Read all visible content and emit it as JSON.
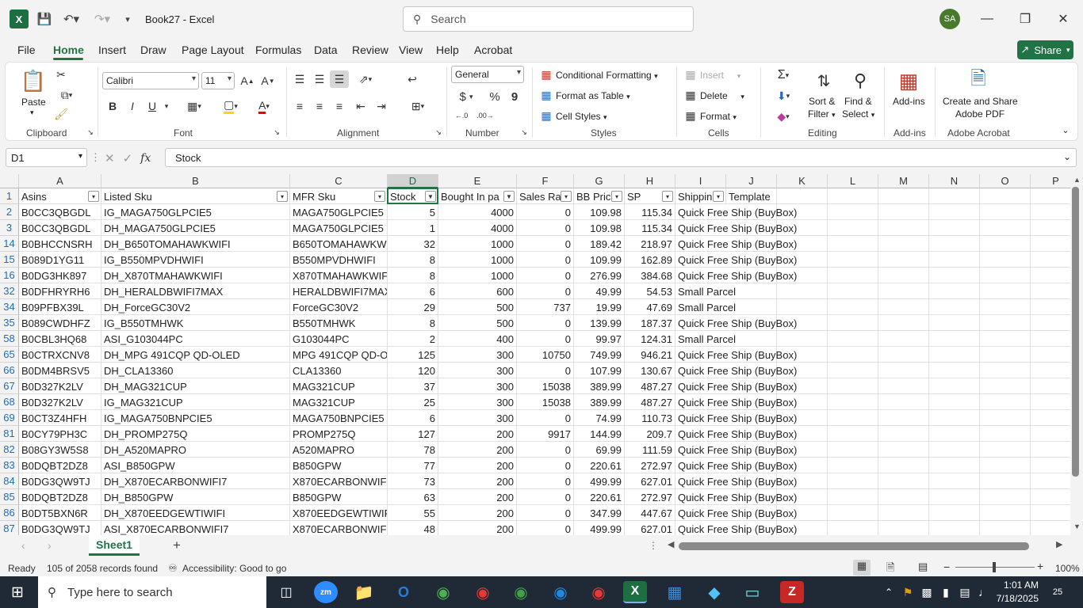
{
  "titlebar": {
    "doc_title": "Book27 - Excel",
    "search_placeholder": "Search",
    "user_initials": "SA"
  },
  "menu": {
    "tabs": [
      "File",
      "Home",
      "Insert",
      "Draw",
      "Page Layout",
      "Formulas",
      "Data",
      "Review",
      "View",
      "Help",
      "Acrobat"
    ],
    "active_tab": "Home",
    "share_label": "Share"
  },
  "ribbon": {
    "clipboard": {
      "paste": "Paste",
      "label": "Clipboard"
    },
    "font": {
      "name": "Calibri",
      "size": "11",
      "bold": "B",
      "italic": "I",
      "underline": "U",
      "label": "Font"
    },
    "alignment": {
      "label": "Alignment"
    },
    "number": {
      "format": "General",
      "currency": "$",
      "percent": "%",
      "comma": "9",
      "label": "Number"
    },
    "styles": {
      "conditional": "Conditional Formatting",
      "format_table": "Format as Table",
      "cell_styles": "Cell Styles",
      "label": "Styles"
    },
    "cells": {
      "insert": "Insert",
      "delete": "Delete",
      "format": "Format",
      "label": "Cells"
    },
    "editing": {
      "sort": "Sort &",
      "filter": "Filter",
      "find": "Find &",
      "select": "Select",
      "label": "Editing"
    },
    "addins": {
      "button": "Add-ins",
      "label": "Add-ins"
    },
    "acrobat": {
      "line1": "Create and Share",
      "line2": "Adobe PDF",
      "label": "Adobe Acrobat"
    }
  },
  "formula_bar": {
    "name_box": "D1",
    "fx": "fx",
    "content": "Stock"
  },
  "columns": [
    "A",
    "B",
    "C",
    "D",
    "E",
    "F",
    "G",
    "H",
    "I",
    "J",
    "K",
    "L",
    "M",
    "N",
    "O",
    "P"
  ],
  "header_row": {
    "row_num": "1",
    "cells": [
      "Asins",
      "Listed Sku",
      "MFR Sku",
      "Stock",
      "Bought In pa",
      "Sales Ra",
      "BB Pric",
      "SP",
      "Shippin",
      "Template"
    ]
  },
  "rows": [
    {
      "n": "2",
      "a": "B0CC3QBGDL",
      "b": "IG_MAGA750GLPCIE5",
      "c": "MAGA750GLPCIE5",
      "d": "5",
      "e": "4000",
      "f": "0",
      "g": "109.98",
      "h": "115.34",
      "i": "Quick Free Ship (BuyBox)"
    },
    {
      "n": "3",
      "a": "B0CC3QBGDL",
      "b": "DH_MAGA750GLPCIE5",
      "c": "MAGA750GLPCIE5",
      "d": "1",
      "e": "4000",
      "f": "0",
      "g": "109.98",
      "h": "115.34",
      "i": "Quick Free Ship (BuyBox)"
    },
    {
      "n": "14",
      "a": "B0BHCCNSRH",
      "b": "DH_B650TOMAHAWKWIFI",
      "c": "B650TOMAHAWKW",
      "d": "32",
      "e": "1000",
      "f": "0",
      "g": "189.42",
      "h": "218.97",
      "i": "Quick Free Ship (BuyBox)"
    },
    {
      "n": "15",
      "a": "B089D1YG11",
      "b": "IG_B550MPVDHWIFI",
      "c": "B550MPVDHWIFI",
      "d": "8",
      "e": "1000",
      "f": "0",
      "g": "109.99",
      "h": "162.89",
      "i": "Quick Free Ship (BuyBox)"
    },
    {
      "n": "16",
      "a": "B0DG3HK897",
      "b": "DH_X870TMAHAWKWIFI",
      "c": "X870TMAHAWKWIF",
      "d": "8",
      "e": "1000",
      "f": "0",
      "g": "276.99",
      "h": "384.68",
      "i": "Quick Free Ship (BuyBox)"
    },
    {
      "n": "32",
      "a": "B0DFHRYRH6",
      "b": "DH_HERALDBWIFI7MAX",
      "c": "HERALDBWIFI7MAX",
      "d": "6",
      "e": "600",
      "f": "0",
      "g": "49.99",
      "h": "54.53",
      "i": "Small Parcel"
    },
    {
      "n": "34",
      "a": "B09PFBX39L",
      "b": "DH_ForceGC30V2",
      "c": "ForceGC30V2",
      "d": "29",
      "e": "500",
      "f": "737",
      "g": "19.99",
      "h": "47.69",
      "i": "Small Parcel"
    },
    {
      "n": "35",
      "a": "B089CWDHFZ",
      "b": "IG_B550TMHWK",
      "c": "B550TMHWK",
      "d": "8",
      "e": "500",
      "f": "0",
      "g": "139.99",
      "h": "187.37",
      "i": "Quick Free Ship (BuyBox)"
    },
    {
      "n": "58",
      "a": "B0CBL3HQ68",
      "b": "ASI_G103044PC",
      "c": "G103044PC",
      "d": "2",
      "e": "400",
      "f": "0",
      "g": "99.97",
      "h": "124.31",
      "i": "Small Parcel"
    },
    {
      "n": "65",
      "a": "B0CTRXCNV8",
      "b": "DH_MPG 491CQP QD-OLED",
      "c": "MPG 491CQP QD-OL",
      "d": "125",
      "e": "300",
      "f": "10750",
      "g": "749.99",
      "h": "946.21",
      "i": "Quick Free Ship (BuyBox)"
    },
    {
      "n": "66",
      "a": "B0DM4BRSV5",
      "b": "DH_CLA13360",
      "c": "CLA13360",
      "d": "120",
      "e": "300",
      "f": "0",
      "g": "107.99",
      "h": "130.67",
      "i": "Quick Free Ship (BuyBox)"
    },
    {
      "n": "67",
      "a": "B0D327K2LV",
      "b": "DH_MAG321CUP",
      "c": "MAG321CUP",
      "d": "37",
      "e": "300",
      "f": "15038",
      "g": "389.99",
      "h": "487.27",
      "i": "Quick Free Ship (BuyBox)"
    },
    {
      "n": "68",
      "a": "B0D327K2LV",
      "b": "IG_MAG321CUP",
      "c": "MAG321CUP",
      "d": "25",
      "e": "300",
      "f": "15038",
      "g": "389.99",
      "h": "487.27",
      "i": "Quick Free Ship (BuyBox)"
    },
    {
      "n": "69",
      "a": "B0CT3Z4HFH",
      "b": "IG_MAGA750BNPCIE5",
      "c": "MAGA750BNPCIE5",
      "d": "6",
      "e": "300",
      "f": "0",
      "g": "74.99",
      "h": "110.73",
      "i": "Quick Free Ship (BuyBox)"
    },
    {
      "n": "81",
      "a": "B0CY79PH3C",
      "b": "DH_PROMP275Q",
      "c": "PROMP275Q",
      "d": "127",
      "e": "200",
      "f": "9917",
      "g": "144.99",
      "h": "209.7",
      "i": "Quick Free Ship (BuyBox)"
    },
    {
      "n": "82",
      "a": "B08GY3W5S8",
      "b": "DH_A520MAPRO",
      "c": "A520MAPRO",
      "d": "78",
      "e": "200",
      "f": "0",
      "g": "69.99",
      "h": "111.59",
      "i": "Quick Free Ship (BuyBox)"
    },
    {
      "n": "83",
      "a": "B0DQBT2DZ8",
      "b": "ASI_B850GPW",
      "c": "B850GPW",
      "d": "77",
      "e": "200",
      "f": "0",
      "g": "220.61",
      "h": "272.97",
      "i": "Quick Free Ship (BuyBox)"
    },
    {
      "n": "84",
      "a": "B0DG3QW9TJ",
      "b": "DH_X870ECARBONWIFI7",
      "c": "X870ECARBONWIFI7",
      "d": "73",
      "e": "200",
      "f": "0",
      "g": "499.99",
      "h": "627.01",
      "i": "Quick Free Ship (BuyBox)"
    },
    {
      "n": "85",
      "a": "B0DQBT2DZ8",
      "b": "DH_B850GPW",
      "c": "B850GPW",
      "d": "63",
      "e": "200",
      "f": "0",
      "g": "220.61",
      "h": "272.97",
      "i": "Quick Free Ship (BuyBox)"
    },
    {
      "n": "86",
      "a": "B0DT5BXN6R",
      "b": "DH_X870EEDGEWTIWIFI",
      "c": "X870EEDGEWTIWIFI",
      "d": "55",
      "e": "200",
      "f": "0",
      "g": "347.99",
      "h": "447.67",
      "i": "Quick Free Ship (BuyBox)"
    },
    {
      "n": "87",
      "a": "B0DG3QW9TJ",
      "b": "ASI_X870ECARBONWIFI7",
      "c": "X870ECARBONWIFI7",
      "d": "48",
      "e": "200",
      "f": "0",
      "g": "499.99",
      "h": "627.01",
      "i": "Quick Free Ship (BuyBox)"
    }
  ],
  "sheets": {
    "active": "Sheet1",
    "add": "+"
  },
  "status": {
    "ready": "Ready",
    "records": "105 of 2058 records found",
    "accessibility": "Accessibility: Good to go",
    "zoom": "100%"
  },
  "taskbar": {
    "search_placeholder": "Type here to search",
    "time": "1:01 AM",
    "date": "7/18/2025",
    "notif_count": "25"
  },
  "colors": {
    "accent": "#217346",
    "taskbar": "#1f2a36"
  }
}
